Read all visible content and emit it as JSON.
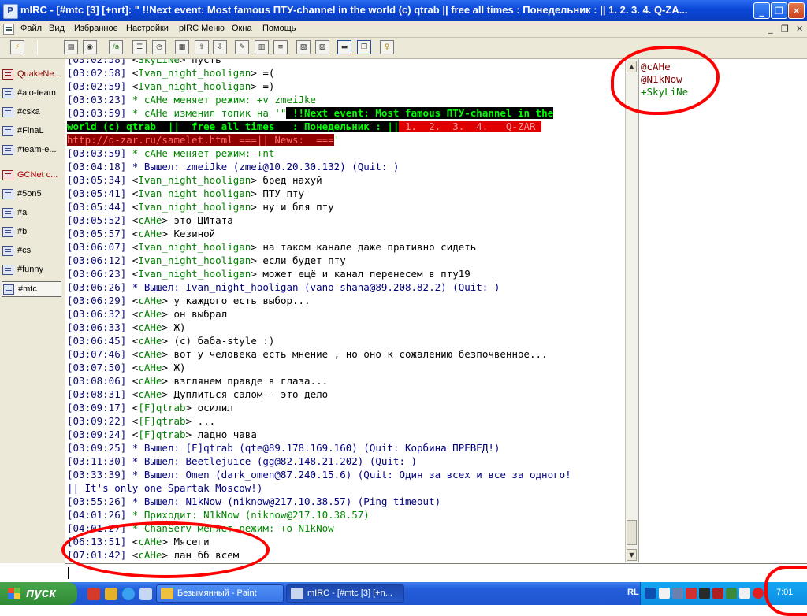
{
  "window": {
    "title": "mIRC - [#mtc [3] [+nrt]: \" !!Next event: Most famous ПТУ-channel in the world (c) qtrab  ||  free all times   : Понедельник : || 1.  2.  3.  4.   Q-ZA..."
  },
  "menu": {
    "items": [
      "Файл",
      "Вид",
      "Избранное",
      "Настройки",
      "pIRC Меню",
      "Окна",
      "Помощь"
    ]
  },
  "switchbar": {
    "items": [
      "QuakeNe...",
      "#aio-team",
      "#cska",
      "#FinaL",
      "#team-e...",
      "GCNet c...",
      "#5on5",
      "#a",
      "#b",
      "#cs",
      "#funny",
      "#mtc"
    ]
  },
  "chat": {
    "topic_prefix": "[03:03:59] * cAHe изменил топик на '\"",
    "topic_part1": " !!Next event: Most famous ПТУ-channel in the",
    "topic_part2": "world (c) qtrab  ||  free all times   : Понедельник : ||",
    "topic_part3": " 1.  2.  3.  4.   Q-ZAR ",
    "topic_part4": "http://q-zar.ru/samelet.html ===|| News:  ===",
    "topic_end": "'",
    "lines": [
      {
        "ts": "[03:02:58]",
        "type": "msg",
        "nick": "SkyLiNe",
        "text": " пусть"
      },
      {
        "ts": "[03:02:58]",
        "type": "msg",
        "nick": "Ivan_night_hooligan",
        "text": " =("
      },
      {
        "ts": "[03:02:59]",
        "type": "msg",
        "nick": "Ivan_night_hooligan",
        "text": " =)"
      },
      {
        "ts": "[03:03:23]",
        "type": "mode",
        "text": " * cAHe меняет режим: +v zmeiJke"
      },
      {
        "ts": "[03:03:59]",
        "type": "mode",
        "text": " * cAHe меняет режим: +nt"
      },
      {
        "ts": "[03:04:18]",
        "type": "quit",
        "text": " * Вышел: zmeiJke (zmei@10.20.30.132) (Quit: )"
      },
      {
        "ts": "[03:05:34]",
        "type": "msg",
        "nick": "Ivan_night_hooligan",
        "text": " бред нахуй"
      },
      {
        "ts": "[03:05:41]",
        "type": "msg",
        "nick": "Ivan_night_hooligan",
        "text": " ПТУ пту"
      },
      {
        "ts": "[03:05:44]",
        "type": "msg",
        "nick": "Ivan_night_hooligan",
        "text": " ну и бля пту"
      },
      {
        "ts": "[03:05:52]",
        "type": "msg",
        "nick": "cAHe",
        "text": " это ЦИтата"
      },
      {
        "ts": "[03:05:57]",
        "type": "msg",
        "nick": "cAHe",
        "text": " Кезиной"
      },
      {
        "ts": "[03:06:07]",
        "type": "msg",
        "nick": "Ivan_night_hooligan",
        "text": " на таком канале даже пративно сидеть"
      },
      {
        "ts": "[03:06:12]",
        "type": "msg",
        "nick": "Ivan_night_hooligan",
        "text": " если будет пту"
      },
      {
        "ts": "[03:06:23]",
        "type": "msg",
        "nick": "Ivan_night_hooligan",
        "text": " может ещё и канал перенесем в пту19"
      },
      {
        "ts": "[03:06:26]",
        "type": "quit",
        "text": " * Вышел: Ivan_night_hooligan (vano-shana@89.208.82.2) (Quit: )"
      },
      {
        "ts": "[03:06:29]",
        "type": "msg",
        "nick": "cAHe",
        "text": " у каждого есть выбор..."
      },
      {
        "ts": "[03:06:32]",
        "type": "msg",
        "nick": "cAHe",
        "text": " он выбрал"
      },
      {
        "ts": "[03:06:33]",
        "type": "msg",
        "nick": "cAHe",
        "text": " Ж)"
      },
      {
        "ts": "[03:06:45]",
        "type": "msg",
        "nick": "cAHe",
        "text": " (с) баба-style :)"
      },
      {
        "ts": "[03:07:46]",
        "type": "msg",
        "nick": "cAHe",
        "text": " вот у человека есть мнение , но оно к сожалению безпочвенное..."
      },
      {
        "ts": "[03:07:50]",
        "type": "msg",
        "nick": "cAHe",
        "text": " Ж)"
      },
      {
        "ts": "[03:08:06]",
        "type": "msg",
        "nick": "cAHe",
        "text": " взглянем правде в глаза..."
      },
      {
        "ts": "[03:08:31]",
        "type": "msg",
        "nick": "cAHe",
        "text": " Дуплиться салом - это дело"
      },
      {
        "ts": "[03:09:17]",
        "type": "msg",
        "nick": "[F]qtrab",
        "text": " осилил"
      },
      {
        "ts": "[03:09:22]",
        "type": "msg",
        "nick": "[F]qtrab",
        "text": " ..."
      },
      {
        "ts": "[03:09:24]",
        "type": "msg",
        "nick": "[F]qtrab",
        "text": " ладно чава"
      },
      {
        "ts": "[03:09:25]",
        "type": "quit",
        "text": " * Вышел: [F]qtrab (qte@89.178.169.160) (Quit: Корбина ПРЕВЕД!)"
      },
      {
        "ts": "[03:11:30]",
        "type": "quit",
        "text": " * Вышел: Beetlejuice (gg@82.148.21.202) (Quit: )"
      },
      {
        "ts": "[03:33:39]",
        "type": "quit",
        "text": " * Вышел: Omen (dark_omen@87.240.15.6) (Quit: Один за всех и все за одного!"
      },
      {
        "ts": "",
        "type": "quit",
        "text": "|| It's only one Spartak Moscow!)"
      },
      {
        "ts": "[03:55:26]",
        "type": "quit",
        "text": " * Вышел: N1kNow (niknow@217.10.38.57) (Ping timeout)"
      },
      {
        "ts": "[04:01:26]",
        "type": "join",
        "text": " * Приходит: N1kNow (niknow@217.10.38.57)"
      },
      {
        "ts": "[04:01:27]",
        "type": "mode",
        "text": " * ChanServ меняет режим: +o N1kNow"
      },
      {
        "ts": "[06:13:51]",
        "type": "msg",
        "nick": "cAHe",
        "text": " Мясеги"
      },
      {
        "ts": "[07:01:42]",
        "type": "msg",
        "nick": "cAHe",
        "text": " лан бб всем"
      }
    ]
  },
  "nicklist": {
    "nicks": [
      {
        "name": "@cAHe",
        "kind": "op"
      },
      {
        "name": "@N1kNow",
        "kind": "op"
      },
      {
        "name": "+SkyLiNe",
        "kind": "voice"
      }
    ]
  },
  "taskbar": {
    "start_label": "пуск",
    "tasks": [
      "Безымянный - Paint",
      "mIRC - [#mtc [3] [+n..."
    ],
    "lang": "RL",
    "clock": "7:01"
  },
  "colors": {
    "timestamp": "#0a0a6e",
    "nick": "#008000",
    "op_nick": "#800000",
    "annotation": "#ff0000"
  }
}
